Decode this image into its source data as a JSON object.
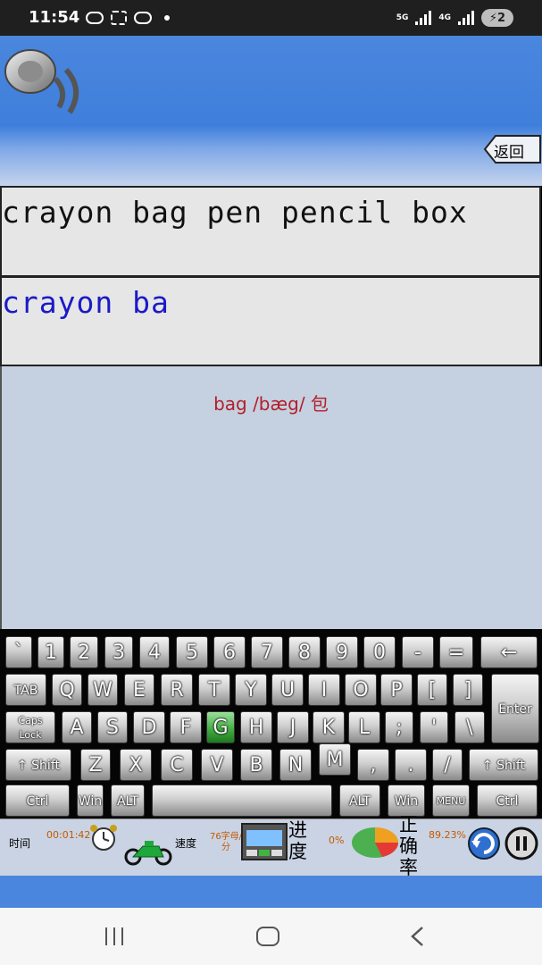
{
  "status_bar": {
    "time": "11:54",
    "net_5g": "5G",
    "net_4g": "4G",
    "battery": "⚡2"
  },
  "header": {
    "back_label": "返回"
  },
  "practice": {
    "target_text": "crayon bag pen pencil box",
    "typed_text": "crayon ba",
    "hint": "bag /bæg/ 包"
  },
  "keyboard": {
    "rows": [
      [
        "`",
        "1",
        "2",
        "3",
        "4",
        "5",
        "6",
        "7",
        "8",
        "9",
        "0",
        "-",
        "=",
        "←"
      ],
      [
        "TAB",
        "Q",
        "W",
        "E",
        "R",
        "T",
        "Y",
        "U",
        "I",
        "O",
        "P",
        "[",
        "]",
        "Enter"
      ],
      [
        "Caps Lock",
        "A",
        "S",
        "D",
        "F",
        "G",
        "H",
        "J",
        "K",
        "L",
        ";",
        "'",
        "\\"
      ],
      [
        "↑ Shift",
        "Z",
        "X",
        "C",
        "V",
        "B",
        "N",
        "M",
        ",",
        ".",
        "/",
        "↑ Shift"
      ],
      [
        "Ctrl",
        "Win",
        "ALT",
        "ALT",
        "Win",
        "MENU",
        "Ctrl"
      ]
    ],
    "active_key": "G"
  },
  "toolbar": {
    "time_label": "时间",
    "time_value": "00:01:42",
    "speed_label": "速度",
    "speed_value": "76字母/分",
    "progress_label": "进度",
    "progress_value": "0%",
    "accuracy_label": "正确率",
    "accuracy_value": "89.23%"
  },
  "colors": {
    "header_blue": "#3f7fdc",
    "typed_blue": "#1a1ac8",
    "hint_red": "#b2202a",
    "active_key_green": "#3fa83f"
  }
}
